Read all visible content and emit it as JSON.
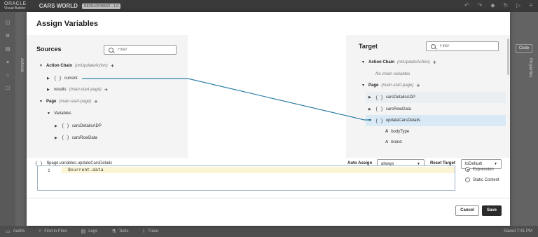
{
  "app": {
    "logo_line1": "ORACLE",
    "logo_line2": "Visual Builder",
    "name": "CARS WORLD",
    "env_badge": "DEVELOPMENT - 1.0"
  },
  "side": {
    "actions_tab": "Actions",
    "properties_tab": "Properties",
    "code_button": "Code"
  },
  "dialog": {
    "title": "Assign Variables",
    "sources": {
      "heading": "Sources",
      "filter_placeholder": "Filter",
      "action_chain_label": "Action Chain",
      "action_chain_hint": "(onUpdateAction)",
      "current_label": "current",
      "results_label": "results",
      "results_hint": "(main-start-page)",
      "page_label": "Page",
      "page_hint": "(main-start-page)",
      "variables_label": "Variables",
      "var1": "carsDetailsADP",
      "var2": "carsRowData"
    },
    "target": {
      "heading": "Target",
      "filter_placeholder": "Filter",
      "action_chain_label": "Action Chain",
      "action_chain_hint": "(onUpdateAction)",
      "no_chain_vars": "No chain variables",
      "page_label": "Page",
      "page_hint": "(main-start-page)",
      "var1": "carsDetailsADP",
      "var2": "carsRowData",
      "var3": "updateCarsDetails",
      "child1": "bodyType",
      "child2": "brand"
    },
    "expression": {
      "path": "$page.variables.updateCarsDetails",
      "auto_assign_label": "Auto Assign",
      "auto_assign_value": "always",
      "reset_target_label": "Reset Target",
      "reset_target_value": "toDefault",
      "line_number": "1",
      "code": "$current.data",
      "mode_expression": "Expression",
      "mode_static": "Static Content"
    },
    "buttons": {
      "cancel": "Cancel",
      "save": "Save"
    }
  },
  "bottom": {
    "audits": "Audits",
    "find": "Find in Files",
    "logs": "Logs",
    "tests": "Tests",
    "trace": "Trace",
    "saved": "Saved 7:41 PM"
  },
  "colors": {
    "mapping_line": "#2e7fa6",
    "selected_row": "#d9e9f5",
    "save_button": "#2b2b2b"
  }
}
